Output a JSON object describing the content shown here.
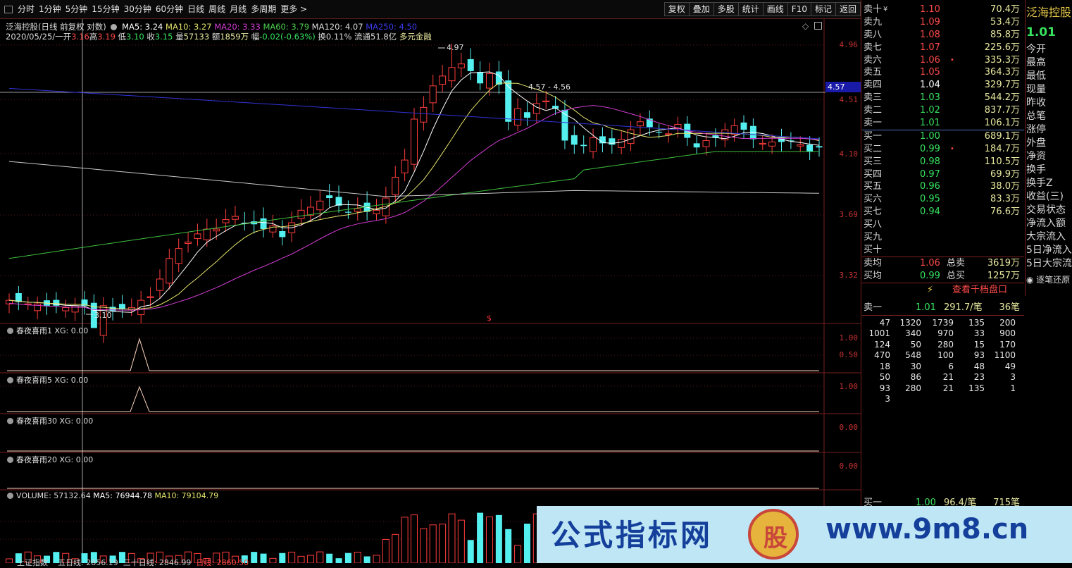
{
  "toolbar": {
    "periods": [
      "分时",
      "1分钟",
      "5分钟",
      "15分钟",
      "30分钟",
      "60分钟",
      "日线",
      "周线",
      "月线",
      "多周期",
      "更多 >"
    ],
    "buttons": [
      "复权",
      "叠加",
      "多股",
      "统计",
      "画线",
      "F10",
      "标记",
      "返回"
    ]
  },
  "chart": {
    "stock_name": "泛海控股",
    "mode": "(日线 前复权 对数)",
    "ma": {
      "ma5": "MA5: 3.24",
      "ma10": "MA10: 3.27",
      "ma20": "MA20: 3.33",
      "ma60": "MA60: 3.79",
      "ma120": "MA120: 4.07",
      "ma250": "MA250: 4.50"
    },
    "date_line": "2020/05/25/一",
    "ohlc": {
      "open_lbl": "开",
      "open": "3.16",
      "high_lbl": "高",
      "high": "3.19",
      "low_lbl": "低",
      "low": "3.10",
      "close_lbl": "收",
      "close": "3.15",
      "vol_lbl": "量",
      "vol": "57133",
      "amt_lbl": "额",
      "amt": "1859万",
      "chg_lbl": "幅",
      "chg": "-0.02(-0.63%)",
      "turn_lbl": "换",
      "turn": "0.11%",
      "float_lbl": "流通",
      "float": "51.8亿",
      "sector": "多元金融"
    },
    "price_axis": [
      "4.96",
      "4.51",
      "4.10",
      "3.69",
      "3.32"
    ],
    "crosshair_price": "4.57",
    "annot_high": "4.97",
    "annot_low": "3.10",
    "annot_range": "4.57 - 4.56",
    "event_marker": "$",
    "colors": {
      "up": "#ff3d3d",
      "down": "#54f0f0",
      "ma5": "#ffffff",
      "ma10": "#e3e36a",
      "ma20": "#d13cd1",
      "ma60": "#3fbf3f",
      "ma120": "#c8c8c8",
      "ma250": "#3232d6"
    }
  },
  "indicators": [
    {
      "title": "春夜喜雨1 XG: 0.00",
      "axis": [
        "1.00",
        "0.50"
      ]
    },
    {
      "title": "春夜喜雨5 XG: 0.00",
      "axis": [
        "1.00"
      ]
    },
    {
      "title": "春夜喜雨30 XG: 0.00",
      "axis": [
        "0.00"
      ]
    },
    {
      "title": "春夜喜雨20 XG: 0.00",
      "axis": [
        "0.00"
      ]
    }
  ],
  "volume": {
    "title": "VOLUME: 57132.64",
    "ma5": "MA5: 76944.78",
    "ma10": "MA10: 79104.79"
  },
  "quote": {
    "sell": [
      {
        "label": "卖十",
        "price": "1.10",
        "vol": "70.4万",
        "dir": "up",
        "mark": "¥"
      },
      {
        "label": "卖九",
        "price": "1.09",
        "vol": "53.4万",
        "dir": "up",
        "mark": ""
      },
      {
        "label": "卖八",
        "price": "1.08",
        "vol": "85.8万",
        "dir": "up",
        "mark": ""
      },
      {
        "label": "卖七",
        "price": "1.07",
        "vol": "225.6万",
        "dir": "up",
        "mark": ""
      },
      {
        "label": "卖六",
        "price": "1.06",
        "vol": "335.3万",
        "dir": "up",
        "mark": "•"
      },
      {
        "label": "卖五",
        "price": "1.05",
        "vol": "364.3万",
        "dir": "up",
        "mark": ""
      },
      {
        "label": "卖四",
        "price": "1.04",
        "vol": "329.7万",
        "dir": "eq",
        "mark": ""
      },
      {
        "label": "卖三",
        "price": "1.03",
        "vol": "544.2万",
        "dir": "dn",
        "mark": ""
      },
      {
        "label": "卖二",
        "price": "1.02",
        "vol": "837.7万",
        "dir": "dn",
        "mark": ""
      },
      {
        "label": "卖一",
        "price": "1.01",
        "vol": "106.1万",
        "dir": "dn",
        "mark": ""
      }
    ],
    "buy": [
      {
        "label": "买一",
        "price": "1.00",
        "vol": "689.1万",
        "dir": "dn",
        "mark": ""
      },
      {
        "label": "买二",
        "price": "0.99",
        "vol": "184.7万",
        "dir": "dn",
        "mark": "•"
      },
      {
        "label": "买三",
        "price": "0.98",
        "vol": "110.5万",
        "dir": "dn",
        "mark": ""
      },
      {
        "label": "买四",
        "price": "0.97",
        "vol": "69.9万",
        "dir": "dn",
        "mark": ""
      },
      {
        "label": "买五",
        "price": "0.96",
        "vol": "38.0万",
        "dir": "dn",
        "mark": ""
      },
      {
        "label": "买六",
        "price": "0.95",
        "vol": "83.3万",
        "dir": "dn",
        "mark": ""
      },
      {
        "label": "买七",
        "price": "0.94",
        "vol": "76.6万",
        "dir": "dn",
        "mark": ""
      },
      {
        "label": "买八",
        "price": "",
        "vol": "",
        "dir": "dn",
        "mark": ""
      },
      {
        "label": "买九",
        "price": "",
        "vol": "",
        "dir": "dn",
        "mark": ""
      },
      {
        "label": "买十",
        "price": "",
        "vol": "",
        "dir": "dn",
        "mark": ""
      }
    ],
    "avg_sell": {
      "label": "卖均",
      "price": "1.06",
      "tlabel": "总卖",
      "total": "3619万"
    },
    "avg_buy": {
      "label": "买均",
      "price": "0.99",
      "tlabel": "总买",
      "total": "1257万"
    },
    "deep_link": "查看千档盘口",
    "tick_head": {
      "label": "卖一",
      "price": "1.01",
      "vol": "291.7/笔",
      "count": "36笔"
    },
    "ticks": [
      [
        "47",
        "1320",
        "1739",
        "135",
        "200"
      ],
      [
        "1001",
        "340",
        "970",
        "33",
        "900"
      ],
      [
        "124",
        "50",
        "280",
        "15",
        "170"
      ],
      [
        "470",
        "548",
        "100",
        "93",
        "1100"
      ],
      [
        "18",
        "30",
        "6",
        "48",
        "49"
      ],
      [
        "50",
        "86",
        "21",
        "23",
        "3"
      ],
      [
        "93",
        "280",
        "21",
        "135",
        "1"
      ],
      [
        "3",
        "",
        "",
        "",
        ""
      ]
    ],
    "tick_foot": {
      "label": "买一",
      "price": "1.00",
      "vol": "96.4/笔",
      "count": "715笔"
    }
  },
  "stockinfo": {
    "name": "泛海控股",
    "price": "1.01",
    "fields": [
      "今开",
      "最高",
      "最低",
      "现量",
      "昨收",
      "总笔",
      "涨停",
      "外盘",
      "净资",
      "换手",
      "换手Z",
      "收益(三)",
      "交易状态",
      "净流入额",
      "大宗流入",
      "5日净流入",
      "5日大宗流",
      "逐笔还原"
    ]
  },
  "footer": {
    "tab": "上证指数",
    "line1": "五日线: 2856.19",
    "line2": "三十日线: 2846.99",
    "line3": "日线: 2860.50"
  },
  "watermark": {
    "text": "公式指标网",
    "url": "www.9m8.cn",
    "logo_char": "股"
  }
}
